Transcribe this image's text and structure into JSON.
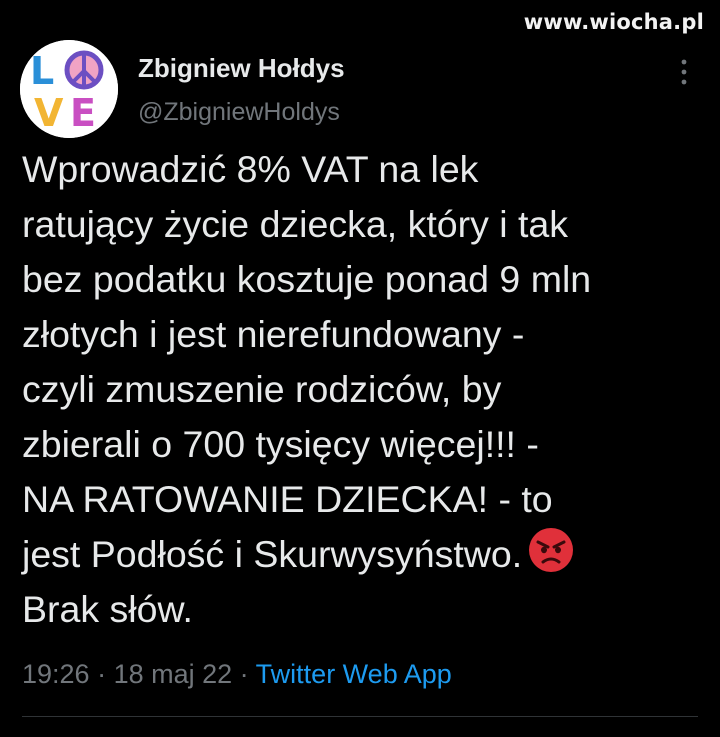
{
  "watermark": "www.wiocha.pl",
  "author": {
    "avatar_text": [
      "L",
      "O",
      "V",
      "E"
    ],
    "avatar_icon": "peace-sign",
    "display_name": "Zbigniew Hołdys",
    "handle": "@ZbigniewHoldys"
  },
  "menu_icon": "more-vertical-icon",
  "tweet": {
    "lines": [
      "Wprowadzić 8% VAT na lek",
      "ratujący życie dziecka, który i tak",
      "bez podatku kosztuje ponad 9 mln",
      "złotych i jest nierefundowany -",
      "czyli zmuszenie rodziców, by",
      "zbierali o 700 tysięcy więcej!!! -",
      "NA RATOWANIE DZIECKA! - to",
      "jest Podłość i Skurwysyństwo.",
      "Brak słów."
    ],
    "emoji": "angry-face"
  },
  "meta": {
    "time": "19:26",
    "separator": " · ",
    "date": "18 maj 22",
    "source": "Twitter Web App"
  },
  "colors": {
    "background": "#000000",
    "text": "#e7e9ea",
    "secondary": "#71767b",
    "link": "#1d9bf0",
    "emoji": "#e0303a"
  }
}
